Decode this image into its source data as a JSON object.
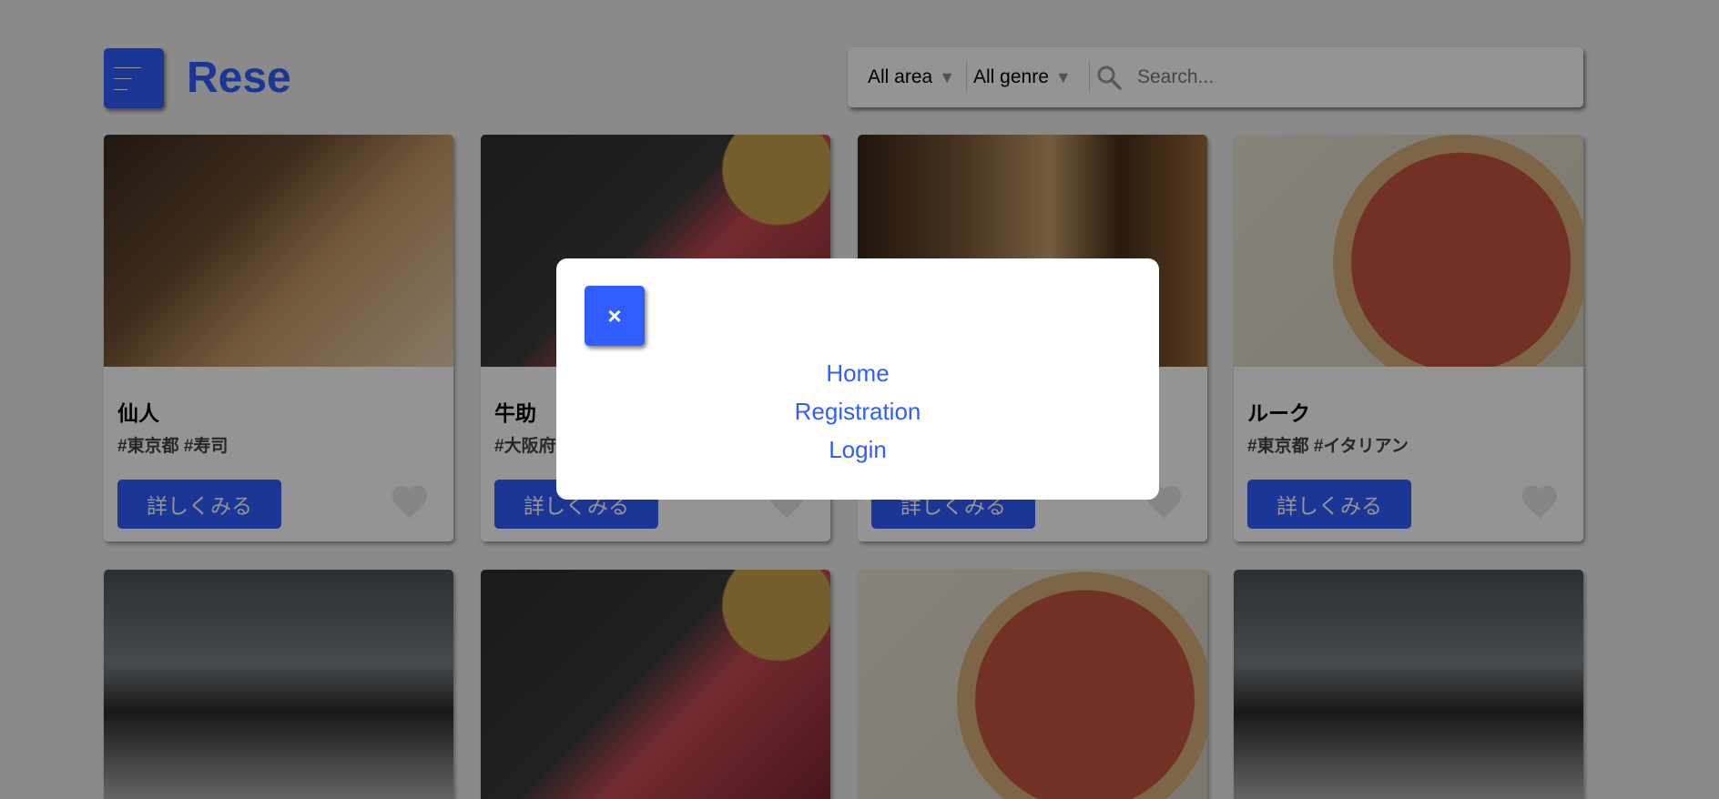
{
  "header": {
    "logo": "Rese",
    "menu_icon": "hamburger-icon"
  },
  "search": {
    "area_value": "All area",
    "genre_value": "All genre",
    "placeholder": "Search...",
    "icon": "search-icon"
  },
  "shops": [
    {
      "name": "仙人",
      "tags": "#東京都 #寿司",
      "button": "詳しくみる"
    },
    {
      "name": "牛助",
      "tags": "#大阪府",
      "button": "詳しくみる"
    },
    {
      "name": "",
      "tags": "",
      "button": "詳しくみる"
    },
    {
      "name": "ルーク",
      "tags": "#東京都 #イタリアン",
      "button": "詳しくみる"
    }
  ],
  "modal": {
    "close_label": "×",
    "links": [
      "Home",
      "Registration",
      "Login"
    ]
  },
  "colors": {
    "accent": "#305dff",
    "background": "#eeeeee",
    "overlay": "rgba(0,0,0,0.42)",
    "heart": "#e6e6e6"
  }
}
